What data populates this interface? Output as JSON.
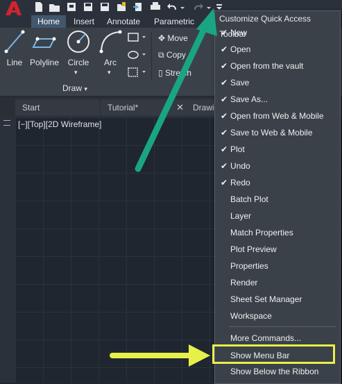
{
  "app": {
    "logo_letter": "A"
  },
  "ribbon": {
    "tabs": [
      {
        "label": "Home",
        "active": true
      },
      {
        "label": "Insert"
      },
      {
        "label": "Annotate"
      },
      {
        "label": "Parametric"
      }
    ],
    "draw_panel": {
      "title": "Draw",
      "tools": [
        {
          "label": "Line"
        },
        {
          "label": "Polyline"
        },
        {
          "label": "Circle"
        },
        {
          "label": "Arc"
        }
      ]
    },
    "modify_panel": {
      "items": [
        {
          "label": "Move"
        },
        {
          "label": "Copy"
        },
        {
          "label": "Stretch"
        }
      ]
    }
  },
  "doc_tabs": [
    {
      "label": "Start"
    },
    {
      "label": "Tutorial*"
    },
    {
      "label": "Drawi"
    }
  ],
  "viewport": {
    "label": "[−][Top][2D Wireframe]"
  },
  "qat_menu": {
    "title": "Customize Quick Access Toolbar",
    "items": [
      {
        "label": "New",
        "checked": true
      },
      {
        "label": "Open",
        "checked": true
      },
      {
        "label": "Open from the vault",
        "checked": true
      },
      {
        "label": "Save",
        "checked": true
      },
      {
        "label": "Save As...",
        "checked": true
      },
      {
        "label": "Open from Web & Mobile",
        "checked": true
      },
      {
        "label": "Save to Web & Mobile",
        "checked": true
      },
      {
        "label": "Plot",
        "checked": true
      },
      {
        "label": "Undo",
        "checked": true
      },
      {
        "label": "Redo",
        "checked": true
      },
      {
        "label": "Batch Plot",
        "checked": false
      },
      {
        "label": "Layer",
        "checked": false
      },
      {
        "label": "Match Properties",
        "checked": false
      },
      {
        "label": "Plot Preview",
        "checked": false
      },
      {
        "label": "Properties",
        "checked": false
      },
      {
        "label": "Render",
        "checked": false
      },
      {
        "label": "Sheet Set Manager",
        "checked": false
      },
      {
        "label": "Workspace",
        "checked": false
      }
    ],
    "more_commands": "More Commands...",
    "show_menu_bar": "Show Menu Bar",
    "show_below_ribbon": "Show Below the Ribbon",
    "check_glyph": "✔"
  },
  "colors": {
    "arrow_teal": "#1aa582",
    "arrow_yellow": "#e7f04a",
    "highlight": "#e7f04a",
    "logo_red": "#d3232f"
  }
}
